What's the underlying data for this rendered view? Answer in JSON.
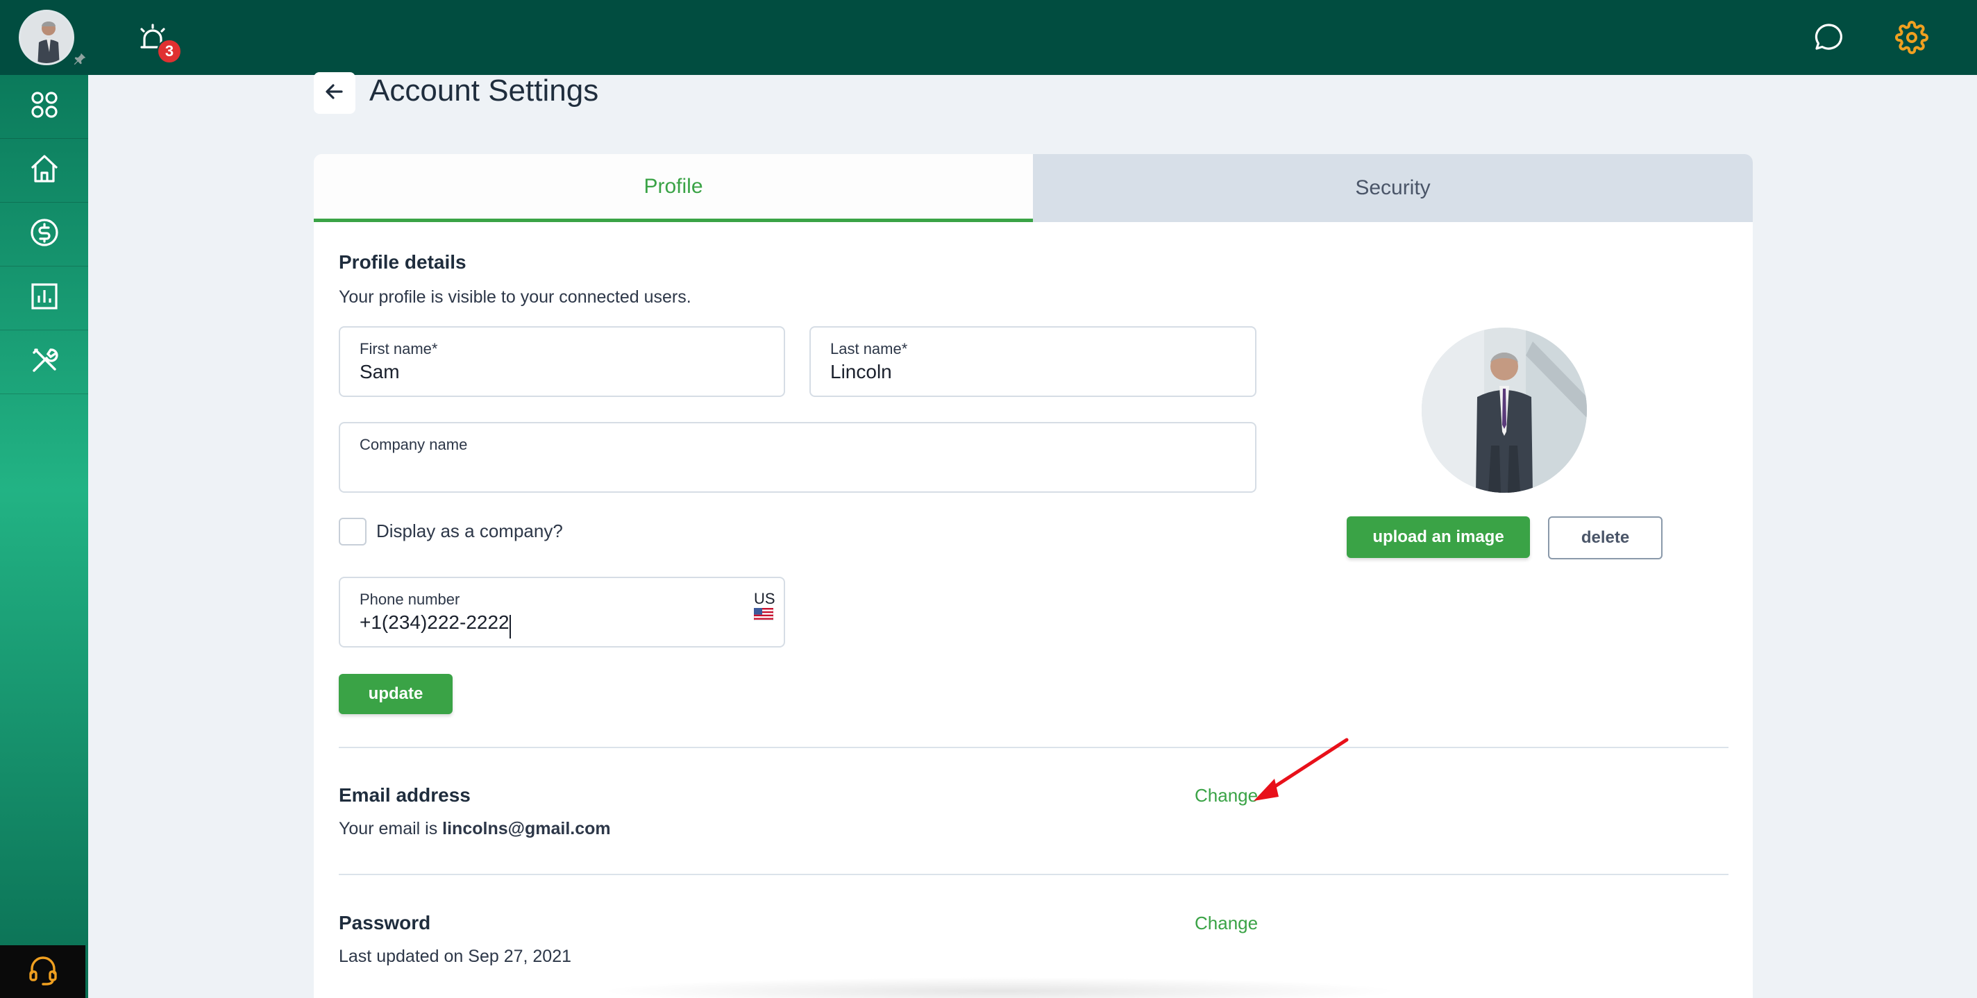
{
  "header": {
    "notification_count": "3",
    "icons": [
      "user-avatar",
      "pin-icon",
      "alarm-bell-icon",
      "chat-icon",
      "gear-icon"
    ]
  },
  "sidebar": {
    "items": [
      {
        "icon": "apps-grid-icon"
      },
      {
        "icon": "home-icon"
      },
      {
        "icon": "dollar-icon"
      },
      {
        "icon": "bar-chart-icon"
      },
      {
        "icon": "tools-icon"
      }
    ],
    "support_icon": "headset-icon"
  },
  "page": {
    "title": "Account Settings"
  },
  "tabs": [
    {
      "label": "Profile",
      "active": true
    },
    {
      "label": "Security",
      "active": false
    }
  ],
  "profile": {
    "heading": "Profile details",
    "subtitle": "Your profile is visible to your connected users.",
    "first_name_label": "First name*",
    "first_name_value": "Sam",
    "last_name_label": "Last name*",
    "last_name_value": "Lincoln",
    "company_label": "Company name",
    "company_value": "",
    "display_company_label": "Display as a company?",
    "phone_label": "Phone number",
    "phone_value": "+1(234)222-2222",
    "phone_country": "US",
    "update_label": "update",
    "upload_label": "upload an image",
    "delete_label": "delete"
  },
  "email": {
    "heading": "Email address",
    "prefix": "Your email is ",
    "address": "lincolns@gmail.com",
    "change_label": "Change"
  },
  "password": {
    "heading": "Password",
    "updated_text": "Last updated on Sep 27, 2021",
    "change_label": "Change"
  },
  "colors": {
    "topbar": "#014d40",
    "accent_green": "#3aa346",
    "badge_red": "#e03131",
    "gear_orange": "#f0a020",
    "annotation_arrow": "#e8101a"
  }
}
